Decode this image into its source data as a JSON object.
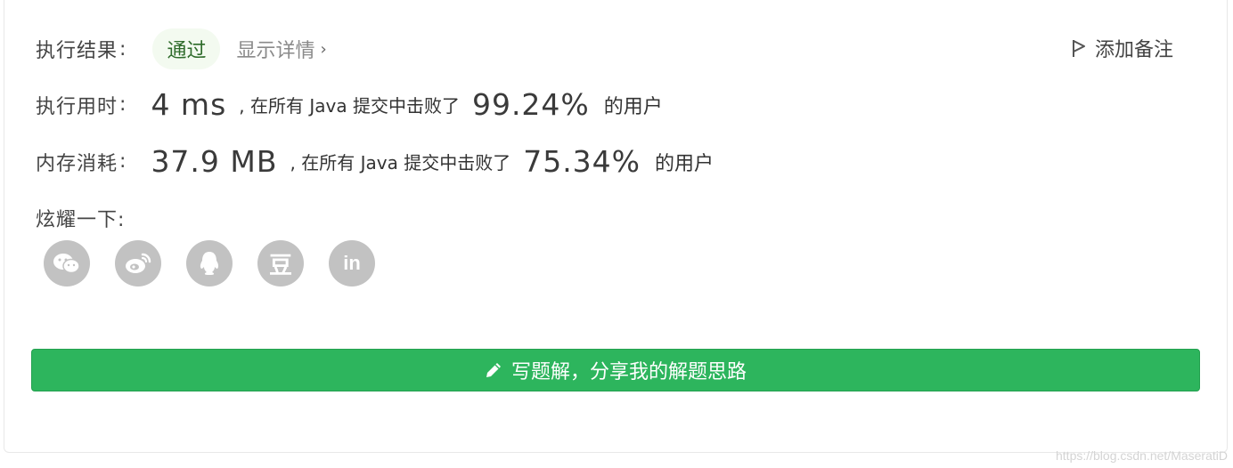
{
  "result": {
    "label": "执行结果",
    "colon": ":",
    "status_badge": "通过",
    "detail_link": "显示详情",
    "detail_chevron": "›",
    "add_note": "添加备注"
  },
  "runtime": {
    "label": "执行用时",
    "colon": ":",
    "value": "4 ms",
    "middle_text": ", 在所有 Java 提交中击败了",
    "percent": "99.24%",
    "tail": "的用户"
  },
  "memory": {
    "label": "内存消耗",
    "colon": ":",
    "value": "37.9 MB",
    "middle_text": ", 在所有 Java 提交中击败了",
    "percent": "75.34%",
    "tail": "的用户"
  },
  "share": {
    "label": "炫耀一下:",
    "icons": [
      "wechat-icon",
      "weibo-icon",
      "qq-icon",
      "douban-icon",
      "linkedin-icon"
    ],
    "douban_glyph": "豆",
    "linkedin_glyph": "in"
  },
  "solution_button": {
    "label": "写题解，分享我的解题思路"
  },
  "watermark": "https://blog.csdn.net/MaseratiD",
  "colors": {
    "accent_green": "#2db55d",
    "badge_bg": "#f3faf0",
    "icon_grey": "#c2c2c2"
  }
}
